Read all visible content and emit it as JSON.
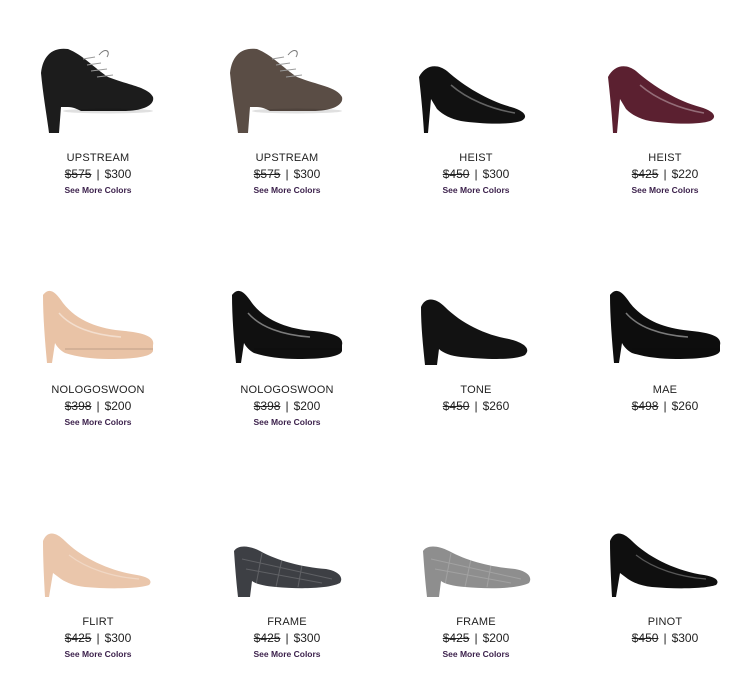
{
  "products": [
    {
      "name": "UPSTREAM",
      "old_price": "$575",
      "sep": "|",
      "price": "$300",
      "link": "See More Colors",
      "style": "oxford",
      "color": "#1c1c1c"
    },
    {
      "name": "UPSTREAM",
      "old_price": "$575",
      "sep": "|",
      "price": "$300",
      "link": "See More Colors",
      "style": "oxford",
      "color": "#5a4d45"
    },
    {
      "name": "HEIST",
      "old_price": "$450",
      "sep": "|",
      "price": "$300",
      "link": "See More Colors",
      "style": "stiletto",
      "color": "#111111"
    },
    {
      "name": "HEIST",
      "old_price": "$425",
      "sep": "|",
      "price": "$220",
      "link": "See More Colors",
      "style": "stiletto",
      "color": "#5b2030"
    },
    {
      "name": "NOLOGOSWOON",
      "old_price": "$398",
      "sep": "|",
      "price": "$200",
      "link": "See More Colors",
      "style": "platform",
      "color": "#e9c3a6"
    },
    {
      "name": "NOLOGOSWOON",
      "old_price": "$398",
      "sep": "|",
      "price": "$200",
      "link": "See More Colors",
      "style": "platform",
      "color": "#101010"
    },
    {
      "name": "TONE",
      "old_price": "$450",
      "sep": "|",
      "price": "$260",
      "link": "",
      "style": "block",
      "color": "#121212"
    },
    {
      "name": "MAE",
      "old_price": "$498",
      "sep": "|",
      "price": "$260",
      "link": "",
      "style": "platform",
      "color": "#0d0d0d"
    },
    {
      "name": "FLIRT",
      "old_price": "$425",
      "sep": "|",
      "price": "$300",
      "link": "See More Colors",
      "style": "pump",
      "color": "#eac6ab"
    },
    {
      "name": "FRAME",
      "old_price": "$425",
      "sep": "|",
      "price": "$300",
      "link": "See More Colors",
      "style": "lowblock",
      "color": "#3d3f44"
    },
    {
      "name": "FRAME",
      "old_price": "$425",
      "sep": "|",
      "price": "$200",
      "link": "See More Colors",
      "style": "lowblock",
      "color": "#8e8e8e"
    },
    {
      "name": "PINOT",
      "old_price": "$450",
      "sep": "|",
      "price": "$300",
      "link": "",
      "style": "pump",
      "color": "#0f0f0f"
    }
  ]
}
